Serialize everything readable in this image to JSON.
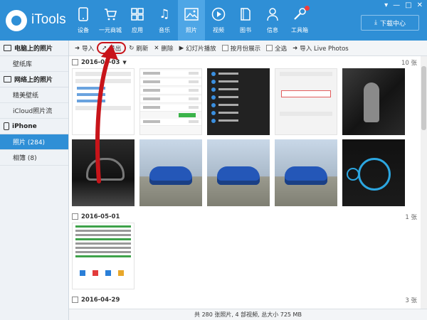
{
  "app": {
    "name": "iTools"
  },
  "nav": [
    {
      "label": "设备",
      "icon": "phone-icon"
    },
    {
      "label": "一元商城",
      "icon": "cart-icon"
    },
    {
      "label": "应用",
      "icon": "apps-icon"
    },
    {
      "label": "音乐",
      "icon": "music-icon"
    },
    {
      "label": "照片",
      "icon": "photo-icon",
      "active": true
    },
    {
      "label": "视频",
      "icon": "video-icon"
    },
    {
      "label": "图书",
      "icon": "book-icon"
    },
    {
      "label": "信息",
      "icon": "message-icon"
    },
    {
      "label": "工具箱",
      "icon": "toolbox-icon",
      "badge": true
    }
  ],
  "download_center": "下载中心",
  "sidebar": {
    "groups": [
      {
        "title": "电脑上的照片",
        "items": [
          {
            "label": "壁纸库"
          }
        ]
      },
      {
        "title": "网络上的照片",
        "items": [
          {
            "label": "精美壁纸"
          },
          {
            "label": "iCloud照片流"
          }
        ]
      },
      {
        "title": "iPhone",
        "items": [
          {
            "label": "照片 (284)",
            "active": true
          },
          {
            "label": "相簿 (8)"
          }
        ]
      }
    ]
  },
  "toolbar": {
    "import": "导入",
    "export": "导出",
    "refresh": "刷新",
    "delete": "删除",
    "slideshow": "幻灯片播放",
    "by_month": "按月份展示",
    "select_all": "全选",
    "import_live": "导入 Live Photos"
  },
  "sections": [
    {
      "date": "2016-05-03",
      "count": "10 张"
    },
    {
      "date": "2016-05-01",
      "count": "1 张"
    },
    {
      "date": "2016-04-29",
      "count": "3 张"
    }
  ],
  "status": "共 280 张照片, 4 部视频, 总大小 725 MB",
  "colors": {
    "brand": "#2f8fd6",
    "annotation": "#c8141a"
  }
}
